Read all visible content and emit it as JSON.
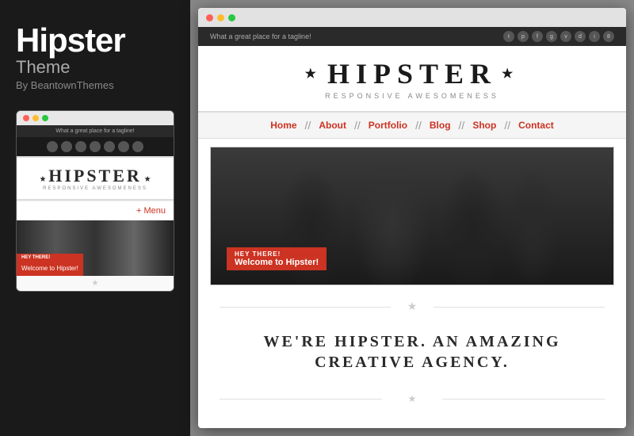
{
  "left": {
    "title_line1": "Hipster",
    "title_line2": "Theme",
    "author": "By BeantownThemes"
  },
  "mobile": {
    "browser_dots": [
      "red",
      "yellow",
      "green"
    ],
    "tagline": "What a great place for a tagline!",
    "logo_star_left": "★",
    "logo_text": "HIPSTER",
    "logo_star_right": "★",
    "logo_tagline": "RESPONSIVE AWESOMENESS",
    "menu_button": "+ Menu",
    "hero_badge_top": "HEY THERE!",
    "hero_badge_bottom": "Welcome to Hipster!",
    "star_divider": "★"
  },
  "desktop": {
    "browser_dots": [
      "red",
      "yellow",
      "green"
    ],
    "tagline": "What a great place for a tagline!",
    "social_icons": [
      "t",
      "p",
      "f",
      "g",
      "v",
      "d",
      "j",
      "8"
    ],
    "logo_star_left": "★",
    "logo_text": "HIPSTER",
    "logo_star_right": "★",
    "logo_tagline": "RESPONSIVE AWESOMENESS",
    "nav": {
      "home": "Home",
      "about": "About",
      "portfolio": "Portfolio",
      "blog": "Blog",
      "shop": "Shop",
      "contact": "Contact",
      "separator": "//"
    },
    "hero_badge_top": "HEY THERE!",
    "hero_badge_bottom": "Welcome to Hipster!",
    "star_divider_top": "★",
    "agency_heading_line1": "WE'RE HIPSTER. AN AMAZING",
    "agency_heading_line2": "CREATIVE AGENCY.",
    "star_divider_bottom": "★"
  }
}
